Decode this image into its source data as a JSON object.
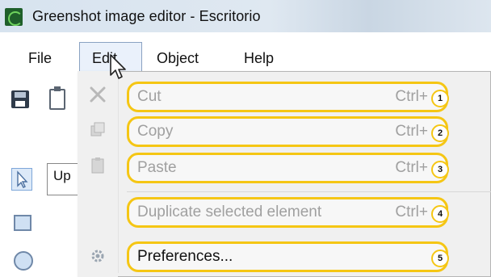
{
  "window": {
    "title": "Greenshot image editor - Escritorio"
  },
  "menubar": {
    "items": [
      "File",
      "Edit",
      "Object",
      "Help"
    ]
  },
  "sidebar": {
    "partial_label": "Up"
  },
  "edit_menu": {
    "items": [
      {
        "label": "Cut",
        "shortcut": "Ctrl+",
        "enabled": false,
        "number": "1",
        "icon": "cut-icon"
      },
      {
        "label": "Copy",
        "shortcut": "Ctrl+",
        "enabled": false,
        "number": "2",
        "icon": "copy-icon"
      },
      {
        "label": "Paste",
        "shortcut": "Ctrl+",
        "enabled": false,
        "number": "3",
        "icon": "paste-icon"
      },
      {
        "label": "Duplicate selected element",
        "shortcut": "Ctrl+",
        "enabled": false,
        "number": "4",
        "icon": ""
      },
      {
        "label": "Preferences...",
        "shortcut": "",
        "enabled": true,
        "number": "5",
        "icon": "gear-icon"
      }
    ]
  },
  "colors": {
    "highlight": "#f5c614",
    "disabled_text": "#a0a0a0",
    "menu_bg": "#f0f0f0"
  }
}
